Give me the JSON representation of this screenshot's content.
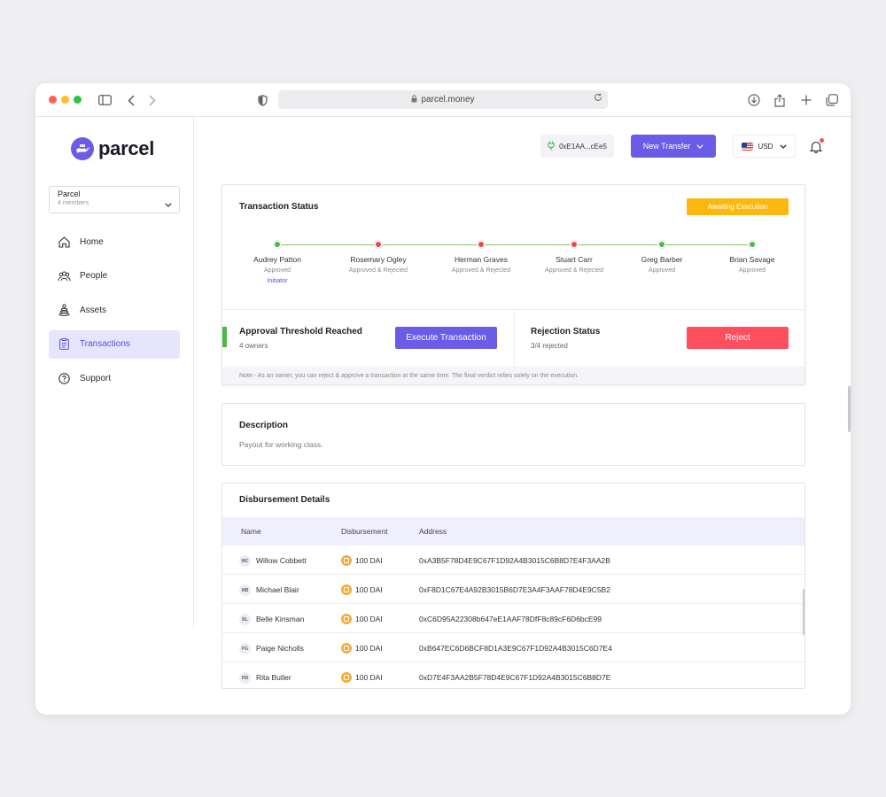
{
  "browser": {
    "url": "parcel.money"
  },
  "sidebar": {
    "logo_text": "parcel",
    "org": {
      "name": "Parcel",
      "members": "4 members"
    },
    "items": [
      {
        "label": "Home",
        "icon": "home-icon"
      },
      {
        "label": "People",
        "icon": "people-icon"
      },
      {
        "label": "Assets",
        "icon": "assets-icon"
      },
      {
        "label": "Transactions",
        "icon": "transactions-icon",
        "active": true
      },
      {
        "label": "Support",
        "icon": "support-icon"
      }
    ]
  },
  "header": {
    "wallet": "0xE1AA...cEe5",
    "new_transfer": "New Transfer",
    "currency": "USD"
  },
  "status": {
    "title": "Transaction Status",
    "badge": "Awaiting Execution",
    "owners": [
      {
        "name": "Audrey Patton",
        "status": "Approved",
        "extra": "Initiator",
        "state": "approved"
      },
      {
        "name": "Rosemary Ogley",
        "status": "Approved & Rejected",
        "state": "rejected"
      },
      {
        "name": "Herman Graves",
        "status": "Approved & Rejected",
        "state": "rejected"
      },
      {
        "name": "Stuart Carr",
        "status": "Approved & Rejected",
        "state": "rejected"
      },
      {
        "name": "Greg Barber",
        "status": "Approved",
        "state": "approved"
      },
      {
        "name": "Brian Savage",
        "status": "Approved",
        "state": "approved"
      }
    ],
    "threshold_title": "Approval Threshold Reached",
    "threshold_sub": "4 owners",
    "execute_label": "Execute Transaction",
    "rejection_title": "Rejection Status",
    "rejection_sub": "3/4 rejected",
    "reject_label": "Reject",
    "note": "Note:- As an owner, you can reject & approve a transaction at the same time. The final verdict relies solely on the execution."
  },
  "description": {
    "title": "Description",
    "text": "Payout for working class."
  },
  "disbursement": {
    "title": "Disbursement Details",
    "columns": [
      "Name",
      "Disbursement",
      "Address"
    ],
    "rows": [
      {
        "initials": "WC",
        "name": "Willow Cobbett",
        "amount": "100 DAI",
        "address": "0xA3B5F78D4E9C67F1D92A4B3015C6B8D7E4F3AA2B"
      },
      {
        "initials": "MB",
        "name": "Michael Blair",
        "amount": "100 DAI",
        "address": "0xF8D1C67E4A92B3015B6D7E3A4F3AAF78D4E9C5B2"
      },
      {
        "initials": "BL",
        "name": "Belle Kinsman",
        "amount": "100 DAI",
        "address": "0xC6D95A22308b647eE1AAF78DfF8c89cF6D6bcE99"
      },
      {
        "initials": "PG",
        "name": "Paige Nicholls",
        "amount": "100 DAI",
        "address": "0xB647EC6D6BCF8D1A3E9C67F1D92A4B3015C6D7E4"
      },
      {
        "initials": "RB",
        "name": "Rita Butler",
        "amount": "100 DAI",
        "address": "0xD7E4F3AA2B5F78D4E9C67F1D92A4B3015C6B8D7E"
      }
    ]
  }
}
